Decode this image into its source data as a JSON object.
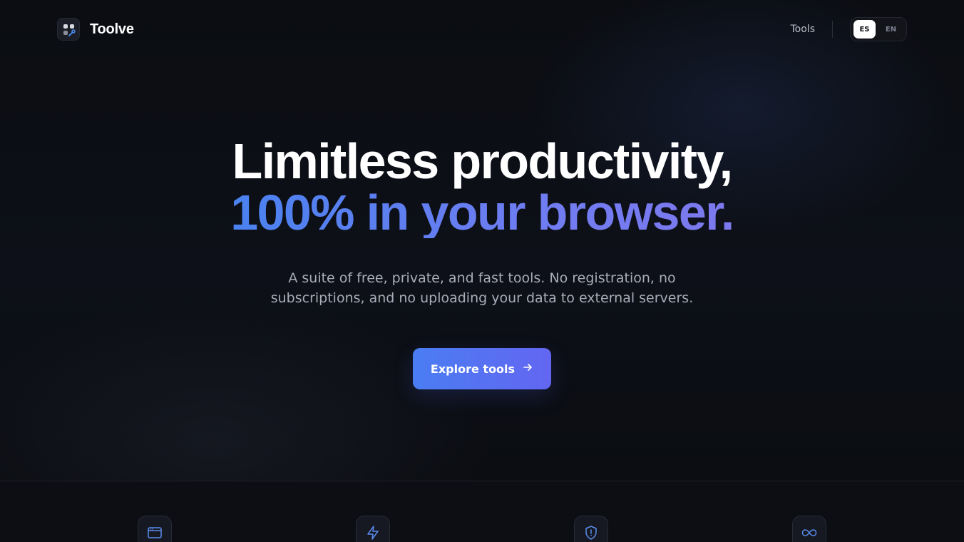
{
  "header": {
    "brand_name": "Toolve",
    "nav_tools": "Tools",
    "languages": [
      {
        "code": "ES",
        "active": true
      },
      {
        "code": "EN",
        "active": false
      }
    ]
  },
  "hero": {
    "title_line1": "Limitless productivity,",
    "title_line2": "100% in your browser.",
    "subtitle": "A suite of free, private, and fast tools. No registration, no subscriptions, and no uploading your data to external servers.",
    "cta_label": "Explore tools",
    "cta_icon": "arrow-right-icon"
  },
  "features": {
    "icons": [
      "browser-window-icon",
      "lightning-bolt-icon",
      "shield-alert-icon",
      "infinity-icon"
    ]
  },
  "colors": {
    "background": "#0b0d12",
    "accent_start": "#4a7df3",
    "accent_end": "#6366f1",
    "text_muted": "#a8adba"
  }
}
